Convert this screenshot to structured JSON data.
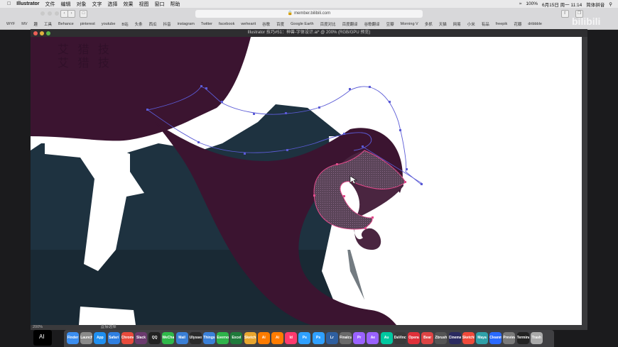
{
  "menubar": {
    "app": "Illustrator",
    "items": [
      "文件",
      "编辑",
      "对象",
      "文字",
      "选择",
      "效果",
      "视图",
      "窗口",
      "帮助"
    ],
    "battery": "100%",
    "datetime": "6月15日 周一  11:14",
    "input": "简体拼音"
  },
  "browser": {
    "url": "member.bilibili.com",
    "bookmarks": [
      "WYF",
      "MV",
      "趣",
      "工具",
      "Behance",
      "pinterest",
      "youtube",
      "B站",
      "头条",
      "西瓜",
      "抖音",
      "instagram",
      "Twitter",
      "facebook",
      "wehearit",
      "谷歌",
      "百度",
      "Google Earth",
      "百度对比",
      "百度翻译",
      "谷歌翻译",
      "豆瓣",
      "Morning V",
      "多抓",
      "天猫",
      "网易",
      "小米",
      "有品",
      "freepik",
      "花瓣",
      "dribbble"
    ]
  },
  "illustrator": {
    "title": "Illustrator 技巧#51：神兽-字体设计.ai* @ 200% (RGB/GPU 预览)",
    "zoom": "200%",
    "status": "直接选择",
    "colors": {
      "tentacle": "#3b1430",
      "bg_dark": "#1e3240",
      "path": "#5b5bd6",
      "selected": "#e04a8a"
    }
  },
  "watermark": {
    "top_left": "艾 猎 技",
    "top_left2": "艾 猎 技",
    "brand": "bilibili",
    "ai_left": "AI"
  },
  "dock": {
    "apps": [
      "Finder",
      "Launchpad",
      "App Store",
      "Safari",
      "Chrome",
      "Slack",
      "QQ",
      "WeChat",
      "Mail",
      "Ulysses",
      "Things",
      "Evernote",
      "Excel",
      "Sketch",
      "Ai",
      "Ai",
      "Id",
      "Ps",
      "Ps",
      "Lr",
      "Finalcut",
      "Pr",
      "Ae",
      "Au",
      "DaVinci",
      "Opera",
      "Bear",
      "Zbrush",
      "Cinema",
      "Sketchbook",
      "Maya",
      "Cleanmaster",
      "Preview",
      "Terminal",
      "Trash"
    ]
  }
}
